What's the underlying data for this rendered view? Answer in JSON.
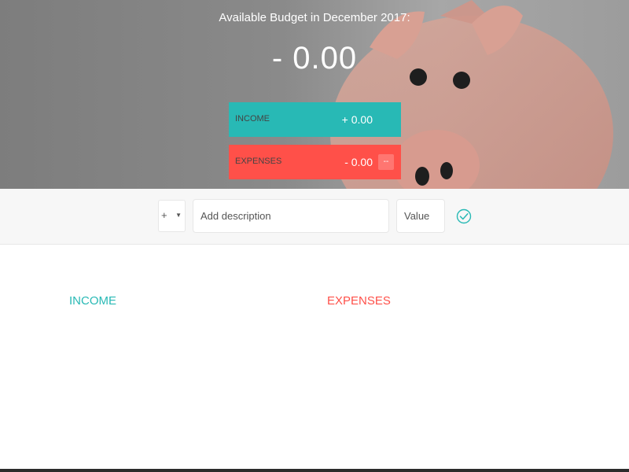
{
  "header": {
    "budget_title": "Available Budget in December 2017:",
    "budget_value": "- 0.00",
    "income_label": "INCOME",
    "income_value": "+ 0.00",
    "expenses_label": "EXPENSES",
    "expenses_value": "- 0.00",
    "expenses_percentage": "--"
  },
  "add_form": {
    "type_selected": "+",
    "description_placeholder": "Add description",
    "value_placeholder": "Value",
    "submit_icon": "checkmark-circle-icon"
  },
  "lists": {
    "income_title": "INCOME",
    "expenses_title": "EXPENSES"
  },
  "colors": {
    "income": "#28b9b5",
    "expenses": "#ff5049"
  }
}
